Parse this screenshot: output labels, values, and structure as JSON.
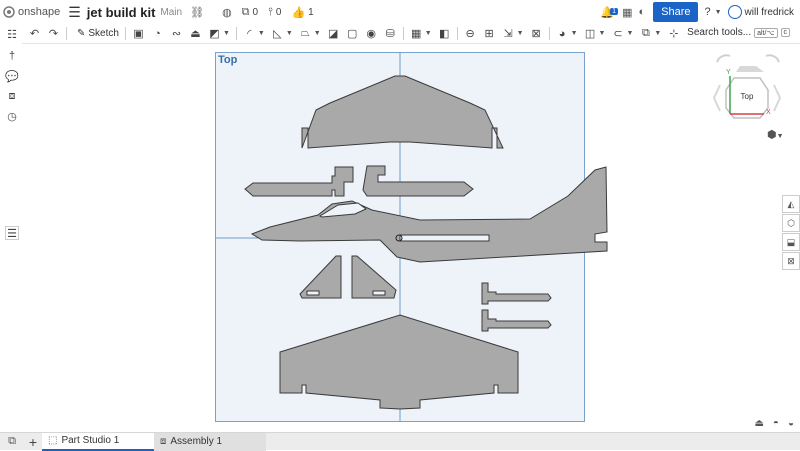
{
  "header": {
    "brand": "onshape",
    "doc_title": "jet build kit",
    "branch": "Main",
    "versions_count": "0",
    "comments_count": "0",
    "likes_count": "1",
    "notification_count": "1",
    "share_label": "Share",
    "user_name": "will fredrick"
  },
  "toolbar": {
    "sketch_label": "Sketch",
    "search_label": "Search tools...",
    "shortcut_label": "alt/⌥",
    "shortcut_key": "c"
  },
  "viewport": {
    "view_label": "Top",
    "cube_label": "Top",
    "axis_y": "Y",
    "axis_x": "X"
  },
  "tabs": [
    {
      "label": "Part Studio 1",
      "active": true
    },
    {
      "label": "Assembly 1",
      "active": false
    }
  ],
  "colors": {
    "accent": "#1a63c7",
    "part_fill": "#a9a9a9",
    "view_border": "#7aa2cf",
    "view_bg": "#edf3f9"
  }
}
